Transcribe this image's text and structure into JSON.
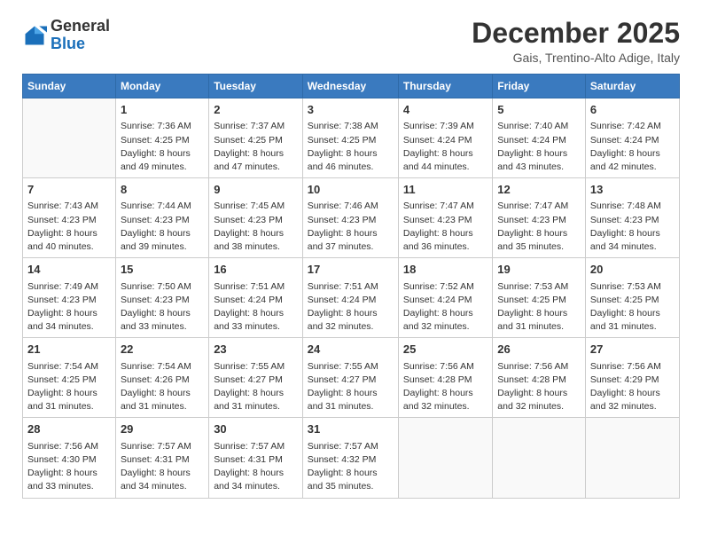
{
  "logo": {
    "general": "General",
    "blue": "Blue"
  },
  "title": "December 2025",
  "location": "Gais, Trentino-Alto Adige, Italy",
  "days_of_week": [
    "Sunday",
    "Monday",
    "Tuesday",
    "Wednesday",
    "Thursday",
    "Friday",
    "Saturday"
  ],
  "weeks": [
    [
      {
        "day": "",
        "info": ""
      },
      {
        "day": "1",
        "info": "Sunrise: 7:36 AM\nSunset: 4:25 PM\nDaylight: 8 hours\nand 49 minutes."
      },
      {
        "day": "2",
        "info": "Sunrise: 7:37 AM\nSunset: 4:25 PM\nDaylight: 8 hours\nand 47 minutes."
      },
      {
        "day": "3",
        "info": "Sunrise: 7:38 AM\nSunset: 4:25 PM\nDaylight: 8 hours\nand 46 minutes."
      },
      {
        "day": "4",
        "info": "Sunrise: 7:39 AM\nSunset: 4:24 PM\nDaylight: 8 hours\nand 44 minutes."
      },
      {
        "day": "5",
        "info": "Sunrise: 7:40 AM\nSunset: 4:24 PM\nDaylight: 8 hours\nand 43 minutes."
      },
      {
        "day": "6",
        "info": "Sunrise: 7:42 AM\nSunset: 4:24 PM\nDaylight: 8 hours\nand 42 minutes."
      }
    ],
    [
      {
        "day": "7",
        "info": "Sunrise: 7:43 AM\nSunset: 4:23 PM\nDaylight: 8 hours\nand 40 minutes."
      },
      {
        "day": "8",
        "info": "Sunrise: 7:44 AM\nSunset: 4:23 PM\nDaylight: 8 hours\nand 39 minutes."
      },
      {
        "day": "9",
        "info": "Sunrise: 7:45 AM\nSunset: 4:23 PM\nDaylight: 8 hours\nand 38 minutes."
      },
      {
        "day": "10",
        "info": "Sunrise: 7:46 AM\nSunset: 4:23 PM\nDaylight: 8 hours\nand 37 minutes."
      },
      {
        "day": "11",
        "info": "Sunrise: 7:47 AM\nSunset: 4:23 PM\nDaylight: 8 hours\nand 36 minutes."
      },
      {
        "day": "12",
        "info": "Sunrise: 7:47 AM\nSunset: 4:23 PM\nDaylight: 8 hours\nand 35 minutes."
      },
      {
        "day": "13",
        "info": "Sunrise: 7:48 AM\nSunset: 4:23 PM\nDaylight: 8 hours\nand 34 minutes."
      }
    ],
    [
      {
        "day": "14",
        "info": "Sunrise: 7:49 AM\nSunset: 4:23 PM\nDaylight: 8 hours\nand 34 minutes."
      },
      {
        "day": "15",
        "info": "Sunrise: 7:50 AM\nSunset: 4:23 PM\nDaylight: 8 hours\nand 33 minutes."
      },
      {
        "day": "16",
        "info": "Sunrise: 7:51 AM\nSunset: 4:24 PM\nDaylight: 8 hours\nand 33 minutes."
      },
      {
        "day": "17",
        "info": "Sunrise: 7:51 AM\nSunset: 4:24 PM\nDaylight: 8 hours\nand 32 minutes."
      },
      {
        "day": "18",
        "info": "Sunrise: 7:52 AM\nSunset: 4:24 PM\nDaylight: 8 hours\nand 32 minutes."
      },
      {
        "day": "19",
        "info": "Sunrise: 7:53 AM\nSunset: 4:25 PM\nDaylight: 8 hours\nand 31 minutes."
      },
      {
        "day": "20",
        "info": "Sunrise: 7:53 AM\nSunset: 4:25 PM\nDaylight: 8 hours\nand 31 minutes."
      }
    ],
    [
      {
        "day": "21",
        "info": "Sunrise: 7:54 AM\nSunset: 4:25 PM\nDaylight: 8 hours\nand 31 minutes."
      },
      {
        "day": "22",
        "info": "Sunrise: 7:54 AM\nSunset: 4:26 PM\nDaylight: 8 hours\nand 31 minutes."
      },
      {
        "day": "23",
        "info": "Sunrise: 7:55 AM\nSunset: 4:27 PM\nDaylight: 8 hours\nand 31 minutes."
      },
      {
        "day": "24",
        "info": "Sunrise: 7:55 AM\nSunset: 4:27 PM\nDaylight: 8 hours\nand 31 minutes."
      },
      {
        "day": "25",
        "info": "Sunrise: 7:56 AM\nSunset: 4:28 PM\nDaylight: 8 hours\nand 32 minutes."
      },
      {
        "day": "26",
        "info": "Sunrise: 7:56 AM\nSunset: 4:28 PM\nDaylight: 8 hours\nand 32 minutes."
      },
      {
        "day": "27",
        "info": "Sunrise: 7:56 AM\nSunset: 4:29 PM\nDaylight: 8 hours\nand 32 minutes."
      }
    ],
    [
      {
        "day": "28",
        "info": "Sunrise: 7:56 AM\nSunset: 4:30 PM\nDaylight: 8 hours\nand 33 minutes."
      },
      {
        "day": "29",
        "info": "Sunrise: 7:57 AM\nSunset: 4:31 PM\nDaylight: 8 hours\nand 34 minutes."
      },
      {
        "day": "30",
        "info": "Sunrise: 7:57 AM\nSunset: 4:31 PM\nDaylight: 8 hours\nand 34 minutes."
      },
      {
        "day": "31",
        "info": "Sunrise: 7:57 AM\nSunset: 4:32 PM\nDaylight: 8 hours\nand 35 minutes."
      },
      {
        "day": "",
        "info": ""
      },
      {
        "day": "",
        "info": ""
      },
      {
        "day": "",
        "info": ""
      }
    ]
  ]
}
